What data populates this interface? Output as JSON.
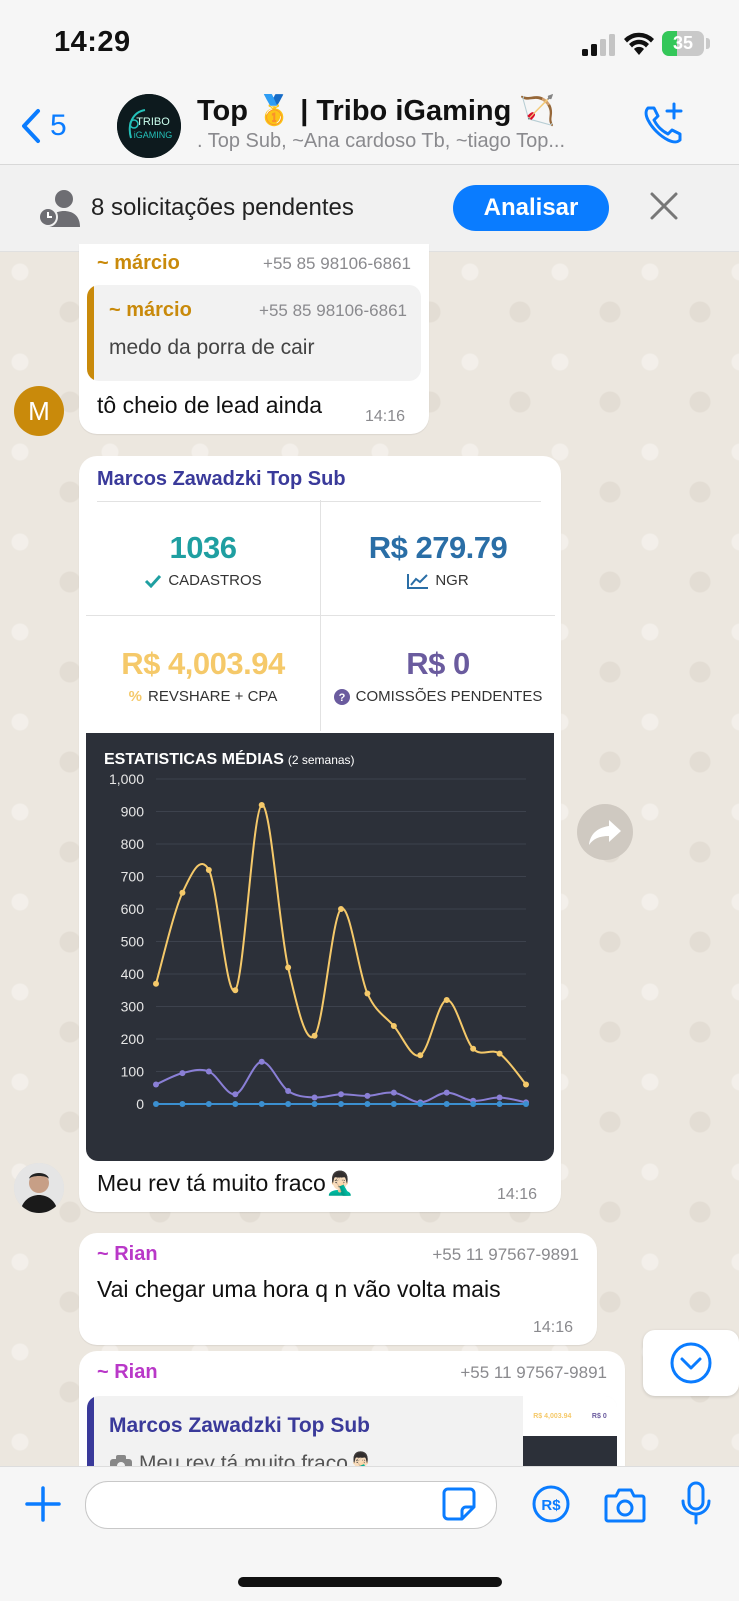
{
  "status_bar": {
    "time": "14:29",
    "battery": "35",
    "battery_level": 0.35
  },
  "header": {
    "back_count": "5",
    "group_name": "Top 🥇 | Tribo iGaming 🏹",
    "members": ". Top Sub, ~Ana cardoso Tb, ~tiago Top...",
    "avatar_text_1": "TRIBO",
    "avatar_text_2": "iGAMING"
  },
  "pending": {
    "text": "8 solicitações pendentes",
    "button": "Analisar"
  },
  "messages": {
    "m1": {
      "sender": "~ márcio",
      "phone": "+55 85 98106-6861",
      "quote_sender": "~ márcio",
      "quote_phone": "+55 85 98106-6861",
      "quote_text": "medo da porra de cair",
      "text": "tô cheio de lead ainda",
      "time": "14:16",
      "avatar_letter": "M"
    },
    "m2": {
      "title": "Marcos Zawadzki Top Sub",
      "text": "Meu rev tá muito fraco🤦🏻‍♂️",
      "time": "14:16"
    },
    "m3": {
      "sender": "~ Rian",
      "phone": "+55 11 97567-9891",
      "text": "Vai chegar uma hora q n vão volta mais",
      "time": "14:16"
    },
    "m4": {
      "sender": "~ Rian",
      "phone": "+55 11 97567-9891",
      "quote_title": "Marcos Zawadzki Top Sub",
      "quote_text": "Meu rev tá muito fraco🤦🏻‍♂️",
      "thumb_value_1": "R$ 4,003.94",
      "thumb_value_2": "R$ 0"
    }
  },
  "stats": {
    "cadastros_value": "1036",
    "cadastros_label": "CADASTROS",
    "ngr_value": "R$ 279.79",
    "ngr_label": "NGR",
    "revshare_value": "R$ 4,003.94",
    "revshare_label": "REVSHARE + CPA",
    "comissoes_value": "R$ 0",
    "comissoes_label": "COMISSÕES PENDENTES"
  },
  "chart_data": {
    "type": "line",
    "title": "ESTATISTICAS MÉDIAS",
    "subtitle": "(2 semanas)",
    "ylim": [
      0,
      1000
    ],
    "yticks": [
      "1,000",
      "900",
      "800",
      "700",
      "600",
      "500",
      "400",
      "300",
      "200",
      "100",
      "0"
    ],
    "grid": true,
    "x": [
      1,
      2,
      3,
      4,
      5,
      6,
      7,
      8,
      9,
      10,
      11,
      12,
      13,
      14,
      15
    ],
    "series": [
      {
        "color": "#f5c96a",
        "values": [
          370,
          650,
          720,
          350,
          920,
          420,
          210,
          600,
          340,
          240,
          150,
          320,
          170,
          155,
          60
        ]
      },
      {
        "color": "#8a7fd6",
        "values": [
          60,
          95,
          100,
          30,
          130,
          40,
          20,
          30,
          25,
          35,
          5,
          35,
          10,
          20,
          5
        ]
      },
      {
        "color": "#3b8fd0",
        "values": [
          0,
          0,
          0,
          0,
          0,
          0,
          0,
          0,
          0,
          0,
          0,
          0,
          0,
          0,
          0
        ]
      }
    ]
  },
  "colors": {
    "accent": "#0a7cff",
    "marcio": "#c98a0b",
    "rian": "#b938c8",
    "cadastros": "#1f9fa1",
    "ngr": "#2a6ea6",
    "revshare": "#f5c96a",
    "comissoes": "#6a5b9e"
  }
}
